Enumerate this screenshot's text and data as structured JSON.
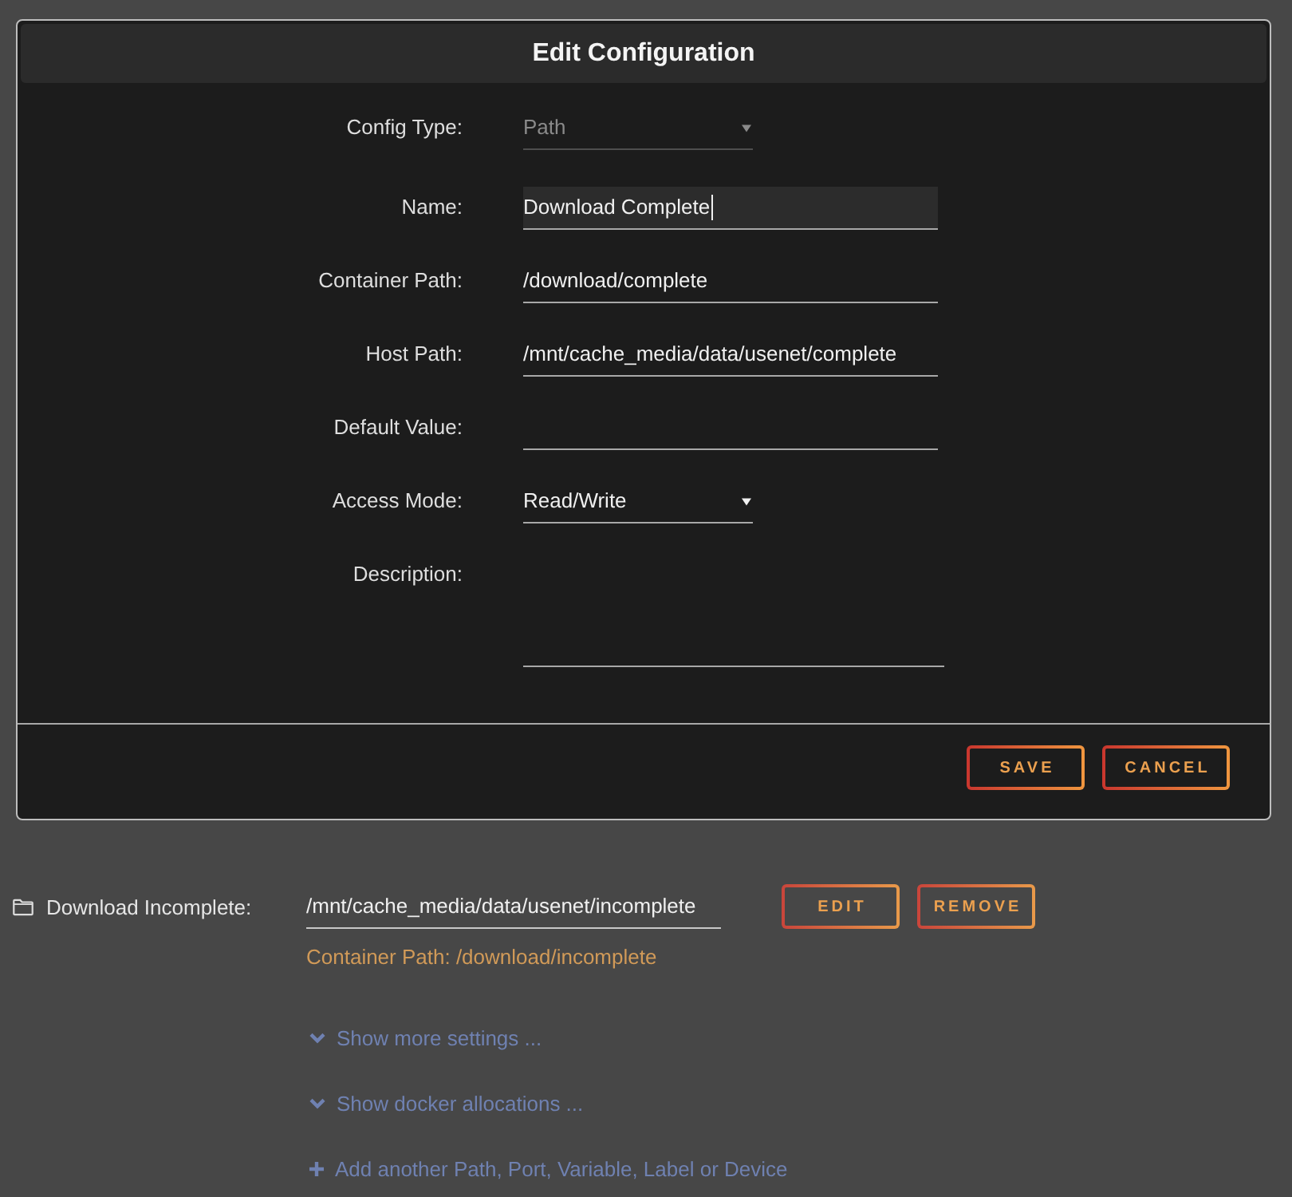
{
  "dialog": {
    "title": "Edit Configuration",
    "fields": [
      {
        "kind": "select",
        "label": "Config Type:",
        "value": "Path",
        "disabled": true,
        "focused": false
      },
      {
        "kind": "text",
        "label": "Name:",
        "value": "Download Complete",
        "disabled": false,
        "focused": true
      },
      {
        "kind": "text",
        "label": "Container Path:",
        "value": "/download/complete",
        "disabled": false,
        "focused": false
      },
      {
        "kind": "text",
        "label": "Host Path:",
        "value": "/mnt/cache_media/data/usenet/complete",
        "disabled": false,
        "focused": false
      },
      {
        "kind": "text",
        "label": "Default Value:",
        "disabled": false,
        "focused": false
      },
      {
        "kind": "select",
        "label": "Access Mode:",
        "value": "Read/Write",
        "disabled": false,
        "focused": false
      },
      {
        "kind": "textarea",
        "label": "Description:",
        "disabled": false,
        "focused": false
      }
    ],
    "buttons": [
      "SAVE",
      "CANCEL"
    ]
  },
  "path_entry": {
    "label": "Download Incomplete:",
    "value": "/mnt/cache_media/data/usenet/incomplete",
    "note": "Container Path: /download/incomplete",
    "buttons": [
      "EDIT",
      "REMOVE"
    ]
  },
  "links": [
    {
      "kind": "expand",
      "label": "Show more settings ..."
    },
    {
      "kind": "expand",
      "label": "Show docker allocations ..."
    },
    {
      "kind": "add",
      "label": "Add another Path, Port, Variable, Label or Device"
    }
  ]
}
